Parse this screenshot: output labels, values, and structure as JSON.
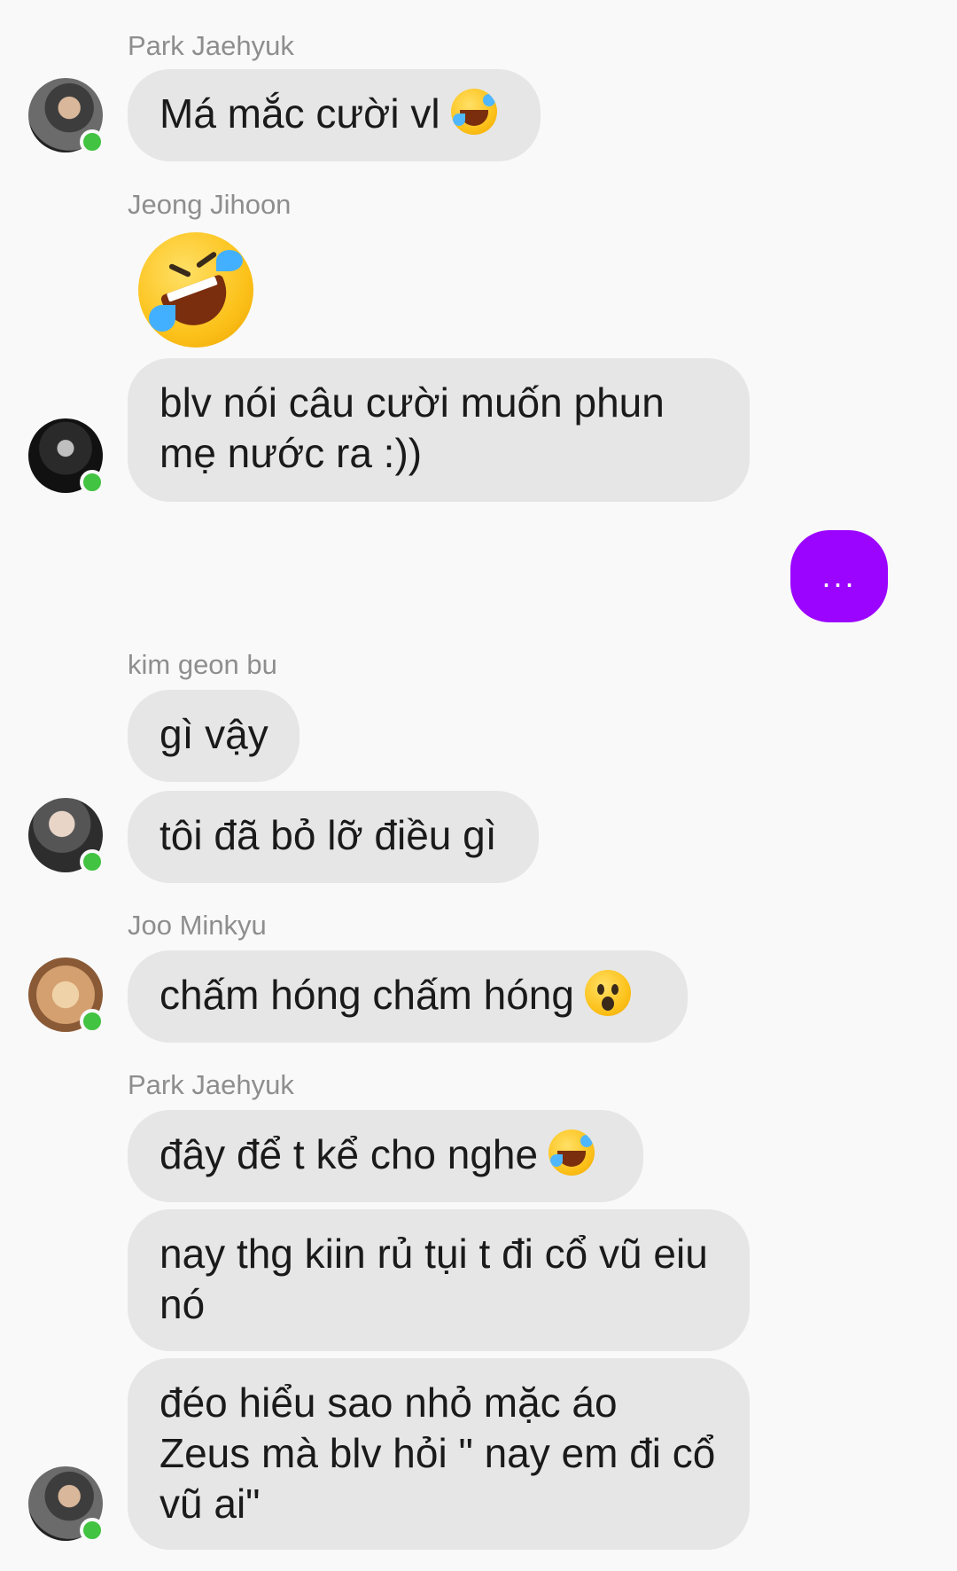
{
  "messages": [
    {
      "sender": "Park Jaehyuk",
      "text": "Má mắc cười vl",
      "emoji": "rolling-on-floor-laughing"
    },
    {
      "sender": "Jeong Jihoon",
      "emoji": "rolling-on-floor-laughing",
      "text": "blv nói câu cười muốn phun mẹ nước ra :))"
    },
    {
      "typing_indicator": "..."
    },
    {
      "sender": "kim geon bu",
      "texts": [
        "gì vậy",
        "tôi đã bỏ lỡ điều gì"
      ]
    },
    {
      "sender": "Joo Minkyu",
      "text": "chấm hóng chấm hóng",
      "emoji": "hushed-face"
    },
    {
      "sender": "Park Jaehyuk",
      "texts": [
        "đây để t kể cho nghe",
        "nay thg kiin rủ tụi t đi cổ vũ eiu nó",
        "đéo hiểu sao nhỏ mặc áo Zeus mà blv hỏi \" nay em đi cổ vũ ai\""
      ],
      "emoji": "rolling-on-floor-laughing"
    }
  ],
  "colors": {
    "bubble_bg": "#e6e6e6",
    "typing_bg": "#9b05ff",
    "online": "#42c342",
    "name_text": "#8e8e8e"
  }
}
